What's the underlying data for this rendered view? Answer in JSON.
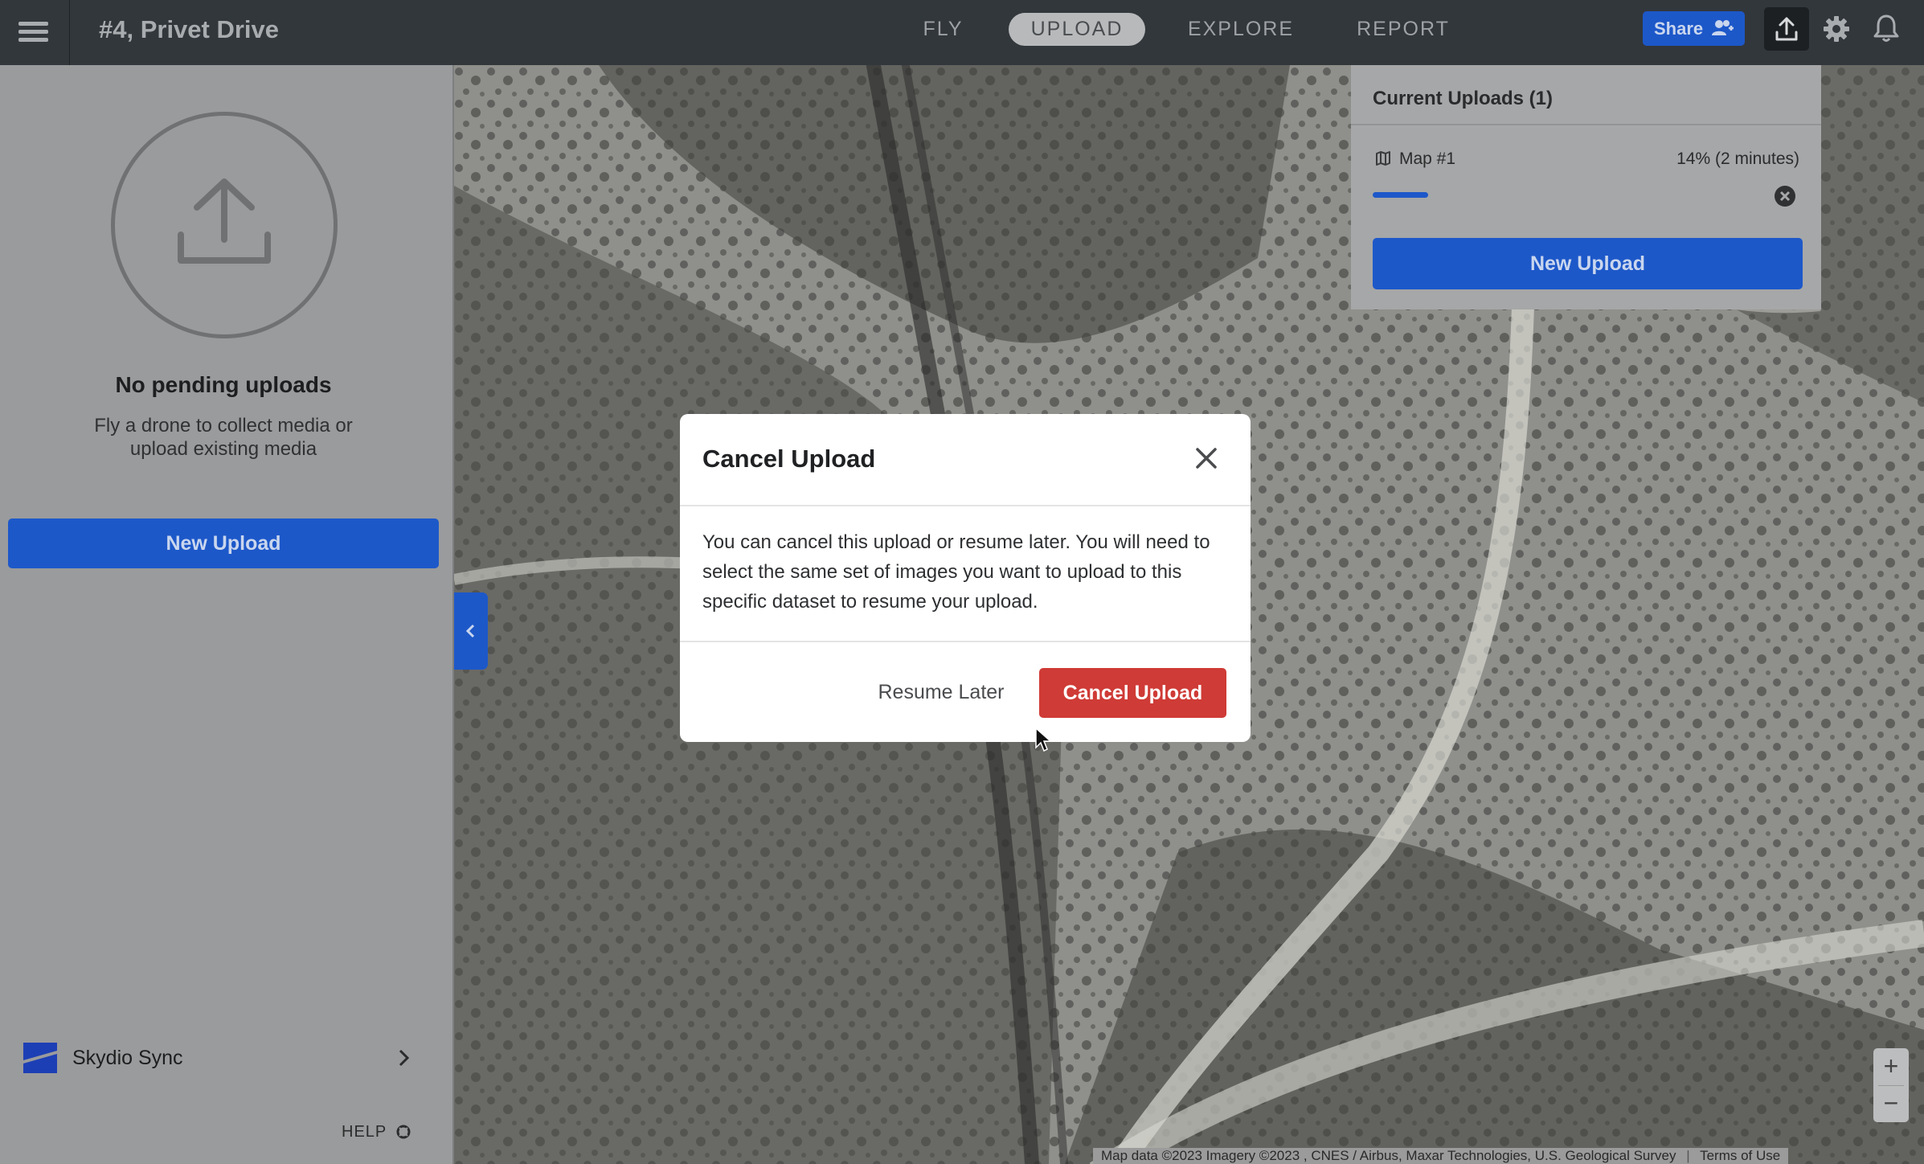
{
  "header": {
    "site_title": "#4, Privet Drive",
    "tabs": [
      {
        "label": "FLY",
        "active": false
      },
      {
        "label": "UPLOAD",
        "active": true
      },
      {
        "label": "EXPLORE",
        "active": false
      },
      {
        "label": "REPORT",
        "active": false
      }
    ],
    "share_label": "Share",
    "icons": [
      "menu-icon",
      "share-people-icon",
      "upload-icon",
      "gear-icon",
      "bell-icon"
    ]
  },
  "sidebar": {
    "empty_title": "No pending uploads",
    "empty_subtitle": "Fly a drone to collect media or upload existing media",
    "new_upload_label": "New Upload",
    "sync_label": "Skydio Sync",
    "help_label": "HELP"
  },
  "uploads_panel": {
    "header": "Current Uploads (1)",
    "items": [
      {
        "name": "Map #1",
        "status": "14% (2 minutes)",
        "progress_percent": 14
      }
    ],
    "new_upload_label": "New Upload"
  },
  "map": {
    "zoom_in": "+",
    "zoom_out": "−",
    "attribution": "Map data ©2023 Imagery ©2023 , CNES / Airbus, Maxar Technologies, U.S. Geological Survey",
    "terms": "Terms of Use"
  },
  "modal": {
    "title": "Cancel Upload",
    "body": "You can cancel this upload or resume later. You will need to select the same set of images you want to upload to this specific dataset to resume your upload.",
    "resume_label": "Resume Later",
    "cancel_label": "Cancel Upload"
  },
  "colors": {
    "accent": "#1d58c9",
    "danger": "#cf3b36",
    "topbar": "#32373c"
  }
}
